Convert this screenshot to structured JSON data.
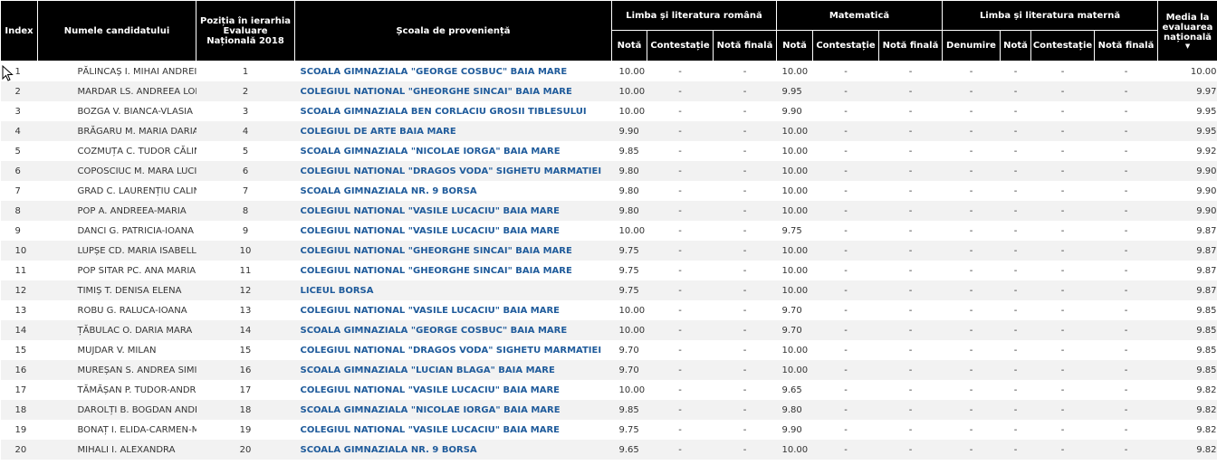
{
  "table": {
    "headers": {
      "index": "Index",
      "name": "Numele candidatului",
      "position": "Poziția în ierarhia Evaluare Națională 2018",
      "school": "Școala de proveniență",
      "romana_group": "Limba și literatura română",
      "mate_group": "Matematică",
      "materna_group": "Limba și literatura maternă",
      "average": "Media la evaluarea națională",
      "nota": "Notă",
      "contestatie": "Contestație",
      "nota_finala": "Notă finală",
      "denumire": "Denumire"
    },
    "dash": "-",
    "rows": [
      {
        "index": "1",
        "name": "PĂLINCAȘ I. MIHAI ANDREI",
        "position": "1",
        "school": "SCOALA GIMNAZIALA \"GEORGE COSBUC\" BAIA MARE",
        "rn": "10.00",
        "mn": "10.00",
        "avg": "10.00"
      },
      {
        "index": "2",
        "name": "MARDAR LS. ANDREEA LORENA",
        "position": "2",
        "school": "COLEGIUL NATIONAL \"GHEORGHE SINCAI\" BAIA MARE",
        "rn": "10.00",
        "mn": "9.95",
        "avg": "9.97"
      },
      {
        "index": "3",
        "name": "BOZGA V. BIANCA-VLASIA",
        "position": "3",
        "school": "SCOALA GIMNAZIALA BEN CORLACIU GROSII TIBLESULUI",
        "rn": "10.00",
        "mn": "9.90",
        "avg": "9.95"
      },
      {
        "index": "4",
        "name": "BRĂGARU M. MARIA DARIA",
        "position": "4",
        "school": "COLEGIUL DE ARTE BAIA MARE",
        "rn": "9.90",
        "mn": "10.00",
        "avg": "9.95"
      },
      {
        "index": "5",
        "name": "COZMUȚA C. TUDOR CĂLIN",
        "position": "5",
        "school": "SCOALA GIMNAZIALA \"NICOLAE IORGA\" BAIA MARE",
        "rn": "9.85",
        "mn": "10.00",
        "avg": "9.92"
      },
      {
        "index": "6",
        "name": "COPOSCIUC M. MARA LUCIANA",
        "position": "6",
        "school": "COLEGIUL NATIONAL \"DRAGOS VODA\" SIGHETU MARMATIEI",
        "rn": "9.80",
        "mn": "10.00",
        "avg": "9.90"
      },
      {
        "index": "7",
        "name": "GRAD C. LAURENȚIU CALIN",
        "position": "7",
        "school": "SCOALA GIMNAZIALA NR. 9 BORSA",
        "rn": "9.80",
        "mn": "10.00",
        "avg": "9.90"
      },
      {
        "index": "8",
        "name": "POP A. ANDREEA-MARIA",
        "position": "8",
        "school": "COLEGIUL NATIONAL \"VASILE LUCACIU\" BAIA MARE",
        "rn": "9.80",
        "mn": "10.00",
        "avg": "9.90"
      },
      {
        "index": "9",
        "name": "DANCI G. PATRICIA-IOANA",
        "position": "9",
        "school": "COLEGIUL NATIONAL \"VASILE LUCACIU\" BAIA MARE",
        "rn": "10.00",
        "mn": "9.75",
        "avg": "9.87"
      },
      {
        "index": "10",
        "name": "LUPȘE CD. MARIA ISABELLA",
        "position": "10",
        "school": "COLEGIUL NATIONAL \"GHEORGHE SINCAI\" BAIA MARE",
        "rn": "9.75",
        "mn": "10.00",
        "avg": "9.87"
      },
      {
        "index": "11",
        "name": "POP SITAR PC. ANA MARIA",
        "position": "11",
        "school": "COLEGIUL NATIONAL \"GHEORGHE SINCAI\" BAIA MARE",
        "rn": "9.75",
        "mn": "10.00",
        "avg": "9.87"
      },
      {
        "index": "12",
        "name": "TIMIȘ T. DENISA ELENA",
        "position": "12",
        "school": "LICEUL BORSA",
        "rn": "9.75",
        "mn": "10.00",
        "avg": "9.87"
      },
      {
        "index": "13",
        "name": "ROBU G. RALUCA-IOANA",
        "position": "13",
        "school": "COLEGIUL NATIONAL \"VASILE LUCACIU\" BAIA MARE",
        "rn": "10.00",
        "mn": "9.70",
        "avg": "9.85"
      },
      {
        "index": "14",
        "name": "ȚĂBULAC O. DARIA MARA",
        "position": "14",
        "school": "SCOALA GIMNAZIALA \"GEORGE COSBUC\" BAIA MARE",
        "rn": "10.00",
        "mn": "9.70",
        "avg": "9.85"
      },
      {
        "index": "15",
        "name": "MUJDAR V. MILAN",
        "position": "15",
        "school": "COLEGIUL NATIONAL \"DRAGOS VODA\" SIGHETU MARMATIEI",
        "rn": "9.70",
        "mn": "10.00",
        "avg": "9.85"
      },
      {
        "index": "16",
        "name": "MUREȘAN S. ANDREA SIMINA",
        "position": "16",
        "school": "SCOALA GIMNAZIALA \"LUCIAN BLAGA\" BAIA MARE",
        "rn": "9.70",
        "mn": "10.00",
        "avg": "9.85"
      },
      {
        "index": "17",
        "name": "TĂMĂȘAN P. TUDOR-ANDREI",
        "position": "17",
        "school": "COLEGIUL NATIONAL \"VASILE LUCACIU\" BAIA MARE",
        "rn": "10.00",
        "mn": "9.65",
        "avg": "9.82"
      },
      {
        "index": "18",
        "name": "DAROLȚI B. BOGDAN ANDREI",
        "position": "18",
        "school": "SCOALA GIMNAZIALA \"NICOLAE IORGA\" BAIA MARE",
        "rn": "9.85",
        "mn": "9.80",
        "avg": "9.82"
      },
      {
        "index": "19",
        "name": "BONAȚ I. ELIDA-CARMEN-MARIA",
        "position": "19",
        "school": "COLEGIUL NATIONAL \"VASILE LUCACIU\" BAIA MARE",
        "rn": "9.75",
        "mn": "9.90",
        "avg": "9.82"
      },
      {
        "index": "20",
        "name": "MIHALI I. ALEXANDRA",
        "position": "20",
        "school": "SCOALA GIMNAZIALA NR. 9 BORSA",
        "rn": "9.65",
        "mn": "10.00",
        "avg": "9.82"
      }
    ]
  },
  "icons": {
    "sort": "sort-descending-icon",
    "cursor": "mouse-pointer-icon"
  },
  "colors": {
    "header_bg": "#000000",
    "school_link": "#1f5b9b",
    "row_alt": "#f2f2f2"
  }
}
